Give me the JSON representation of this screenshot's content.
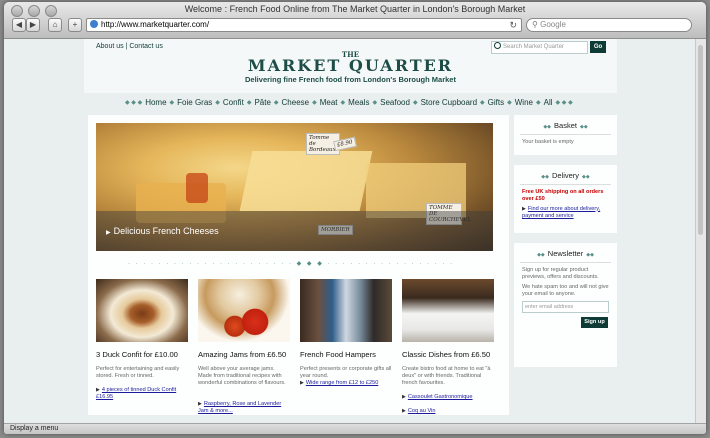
{
  "browser": {
    "window_title": "Welcome : French Food Online from The Market Quarter in London's Borough Market",
    "url": "http://www.marketquarter.com/",
    "search_placeholder": "Google",
    "status_text": "Display a menu"
  },
  "header": {
    "links": [
      "About us",
      "Contact us"
    ],
    "search_placeholder": "Search Market Quarter",
    "go_label": "Go",
    "logo_the": "THE",
    "logo_name": "MARKET QUARTER",
    "tagline": "Delivering fine French food from London's Borough Market"
  },
  "nav": {
    "items": [
      "Home",
      "Foie Gras",
      "Confit",
      "Pâte",
      "Cheese",
      "Meat",
      "Meals",
      "Seafood",
      "Store Cupboard",
      "Gifts",
      "Wine",
      "All"
    ]
  },
  "hero": {
    "caption": "Delicious French Cheeses",
    "tags": [
      "Tomme de Bordeaux",
      "£8.90",
      "MORBIER",
      "TOMME DE COURCHEVEL"
    ]
  },
  "cards": [
    {
      "title": "3 Duck Confit for £10.00",
      "text": "Perfect for entertaining and easily stored. Fresh or tinned.",
      "links": [
        "4 pieces of tinned Duck Confit £16.95"
      ]
    },
    {
      "title": "Amazing Jams from £6.50",
      "text": "Well above your average jams. Made from traditional recipes with wonderful combinations of flavours.",
      "links": [
        "Raspberry, Rose and Lavender Jam & more..."
      ]
    },
    {
      "title": "French Food Hampers",
      "text": "Perfect presents or corporate gifts all year round.",
      "links": [
        "Wide range from £12 to £250"
      ]
    },
    {
      "title": "Classic Dishes from £6.50",
      "text": "Create bistro food at home to eat \"à deux\" or with friends. Traditional french favourites.",
      "links": [
        "Cassoulet Gastronomique",
        "Coq au Vin"
      ]
    }
  ],
  "sidebar": {
    "basket": {
      "title": "Basket",
      "text": "Your basket is empty"
    },
    "delivery": {
      "title": "Delivery",
      "promo": "Free UK shipping on all orders over £50",
      "link": "Find our more about delivery, payment and service"
    },
    "newsletter": {
      "title": "Newsletter",
      "text1": "Sign up for regular product previews, offers and discounts.",
      "text2": "We hate spam too and will not give your email to anyone.",
      "placeholder": "enter email address",
      "button": "Sign up"
    }
  },
  "colors": {
    "brand": "#0f3b36",
    "accent": "#5b8f89",
    "promo": "#c60000",
    "link": "#1b1b9c"
  }
}
